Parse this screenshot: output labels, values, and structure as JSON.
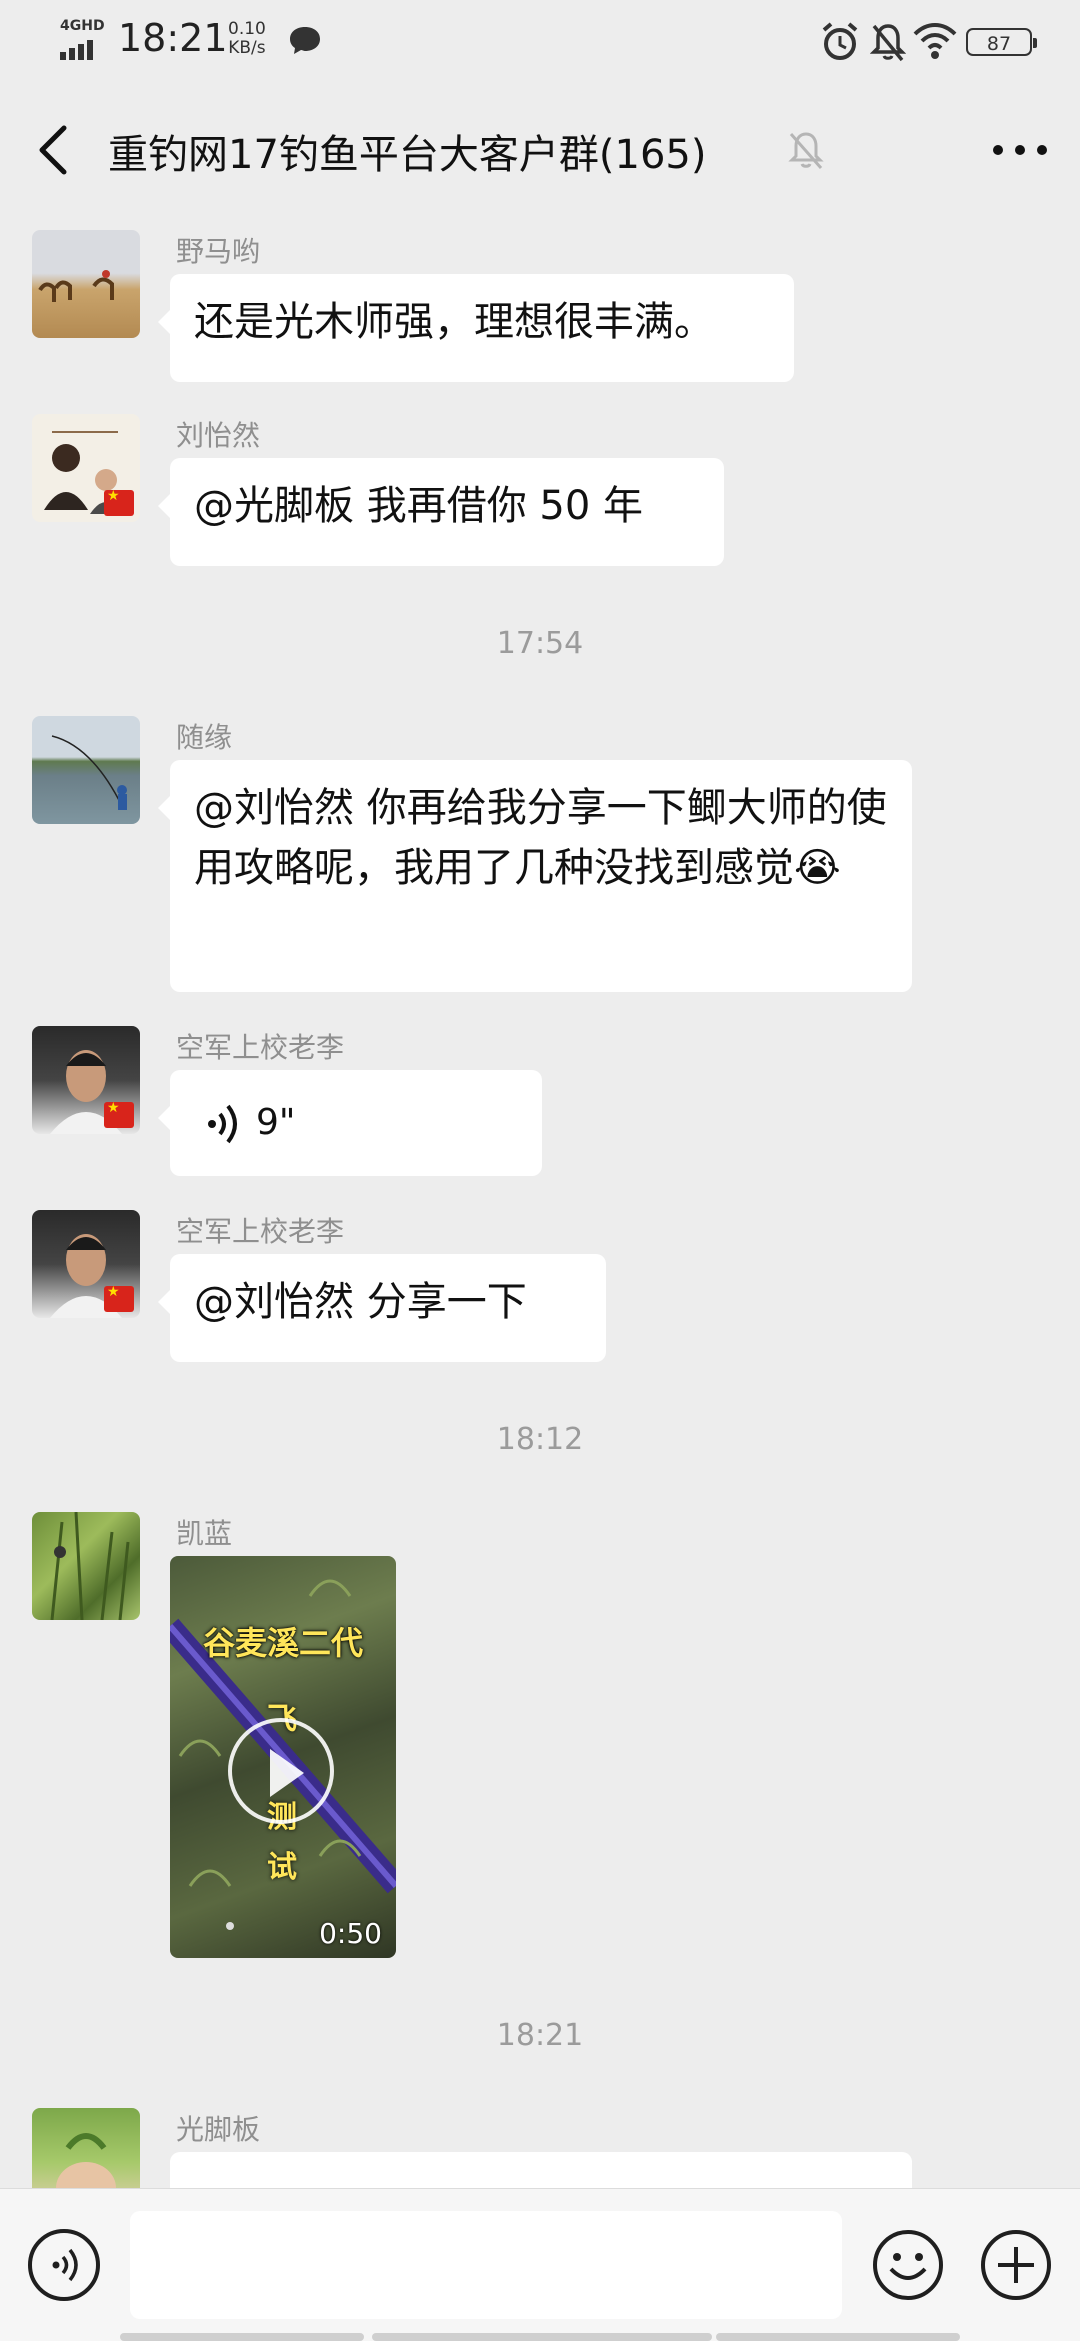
{
  "status_bar": {
    "network": "4GHD",
    "time": "18:21",
    "speed_value": "0.10",
    "speed_unit": "KB/s",
    "battery": "87"
  },
  "header": {
    "title": "重钓网17钓鱼平台大客户群(165)"
  },
  "messages": [
    {
      "sender": "野马哟",
      "text": "还是光木师强，理想很丰满。"
    },
    {
      "sender": "刘怡然",
      "text": "@光脚板  我再借你 50 年"
    },
    {
      "time": "17:54"
    },
    {
      "sender": "随缘",
      "text": "@刘怡然  你再给我分享一下鲫大师的使用攻略呢，我用了几种没找到感觉😭"
    },
    {
      "sender": "空军上校老李",
      "voice": "9\""
    },
    {
      "sender": "空军上校老李",
      "text": "@刘怡然  分享一下"
    },
    {
      "time": "18:12"
    },
    {
      "sender": "凯蓝",
      "video_title": "谷麦溪二代",
      "video_sub1": "飞",
      "video_sub2": "测",
      "video_sub3": "试",
      "video_duration": "0:50"
    },
    {
      "time": "18:21"
    },
    {
      "sender": "光脚板"
    }
  ],
  "colors": {
    "background": "#ededed",
    "bubble": "#ffffff",
    "meta_text": "#9b9b9b"
  }
}
